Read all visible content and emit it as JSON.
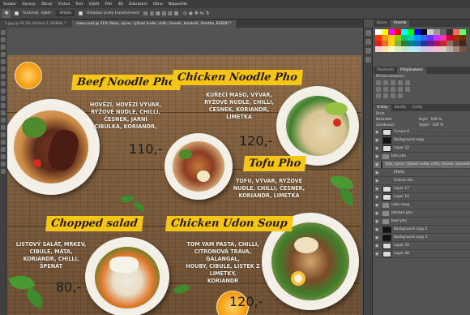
{
  "menubar": [
    "Soubor",
    "Úpravy",
    "Obraz",
    "Vrstva",
    "Text",
    "Výběr",
    "Filtr",
    "3D",
    "Zobrazení",
    "Okno",
    "Nápověda"
  ],
  "options": {
    "autoselect_label": "Automat. výběr:",
    "autoselect_value": "Vrstva",
    "transform_label": "Ovládací prvky transformace"
  },
  "tabs": [
    {
      "label": "1.jpg @ 33,3% (Vrstva 2, RGB/8) *"
    },
    {
      "label": "menu.psd @ 31% (Ikaly, vývar, rýžové nudle, chilli, česnek, koriandr, limetka, RGB/8) *"
    }
  ],
  "menu": {
    "items": [
      {
        "title": "Beef Noodle Pho",
        "desc": "HOVĚZÍ, HOVĚZÍ VÝVAR,\nRÝŽOVÉ NUDLE, CHILLI,\nČESNEK, JARNÍ\nCIBULKA, KORIANDR,",
        "price": "110,-"
      },
      {
        "title": "Chicken Noodle Pho",
        "desc": "KUŘECÍ MASO, VÝVAR,\nRÝŽOVÉ NUDLE, CHILLI,\nČESNEK, KORIANDR,\nLIMETKA",
        "price": "120,-"
      },
      {
        "title": "Tofu Pho",
        "desc": "TOFU, VÝVAR, RÝŽOVÉ\nNUDLE, CHILLI, ČESNEK,\nKORIANDR, LIMETKA",
        "price": ""
      },
      {
        "title": "Chopped salad",
        "desc": "LISTOVÝ SALÁT, MRKEV,\nCIBULE, MÁTA,\nKORIANDR, CHILLI,\nŠPENÁT",
        "price": "80,-"
      },
      {
        "title": "Chicken Udon Soup",
        "desc": "TOM YAM PASTA, CHILLI,\nCITRONOVÁ TRÁVA, GALANGAL,\nHOUBY, CIBULE, LÍSTEK Z LIMETKY,\nKORIANDR",
        "price": "120,-"
      }
    ]
  },
  "panels": {
    "color_tabs": [
      "Barva",
      "Vzorník"
    ],
    "props_tabs": [
      "Vlastnosti",
      "Přizpůsobení"
    ],
    "props_label": "Přidat nastavení",
    "layers_tabs": [
      "Vrstvy",
      "Kanály",
      "Cesty"
    ],
    "kind_label": "Druh",
    "blend_mode": "Normální",
    "opacity_label": "Krytí:",
    "opacity_value": "100 %",
    "lock_label": "Zamknout:",
    "fill_label": "Výplň:",
    "fill_value": "100 %",
    "layers": [
      {
        "name": "Curves 6",
        "thumb": "light",
        "sel": false
      },
      {
        "name": "Background copy",
        "thumb": "dark",
        "sel": false
      },
      {
        "name": "Layer 22",
        "thumb": "light",
        "sel": false
      },
      {
        "name": "tofu pho",
        "thumb": "folder",
        "sel": false
      },
      {
        "name": "tofu, vývar, rýžové nudle, chilli, česnek, koriandr, limetka",
        "thumb": "text",
        "sel": true
      },
      {
        "name": "Efekty",
        "thumb": "none",
        "sel": false
      },
      {
        "name": "Vržený stín",
        "thumb": "none",
        "sel": false
      },
      {
        "name": "Layer 17",
        "thumb": "light",
        "sel": false
      },
      {
        "name": "Layer 14",
        "thumb": "light",
        "sel": false
      },
      {
        "name": "udon soup",
        "thumb": "folder",
        "sel": false
      },
      {
        "name": "chicken pho",
        "thumb": "folder",
        "sel": false
      },
      {
        "name": "beef pho",
        "thumb": "folder",
        "sel": false
      },
      {
        "name": "Background copy 2",
        "thumb": "dark",
        "sel": false
      },
      {
        "name": "Background copy 3",
        "thumb": "dark",
        "sel": false
      },
      {
        "name": "Layer 29",
        "thumb": "light",
        "sel": false
      },
      {
        "name": "Layer 30",
        "thumb": "light",
        "sel": false
      }
    ],
    "swatch_colors": [
      "#ffffff",
      "#ffff00",
      "#ff00ff",
      "#ff0000",
      "#00ffff",
      "#00ff00",
      "#0000ff",
      "#000000",
      "#cccccc",
      "#999999",
      "#666666",
      "#333333",
      "#ff6666",
      "#66ff66",
      "#ff3300",
      "#ff9900",
      "#ffcc00",
      "#99cc00",
      "#00cc66",
      "#00cccc",
      "#0099ff",
      "#3366ff",
      "#6633ff",
      "#cc33ff",
      "#ff3399",
      "#cc0033",
      "#993300",
      "#663300",
      "#e41a1c",
      "#f06d26",
      "#ffd700",
      "#7cb342",
      "#2e7d32",
      "#00838f",
      "#1565c0",
      "#283593",
      "#6a1b9a",
      "#ad1457",
      "#c62828",
      "#8d6e63",
      "#5d4037",
      "#3e2723",
      "#ffcdd2",
      "#ffe0b2",
      "#fff9c4",
      "#dcedc8",
      "#c8e6c9",
      "#b2ebf2",
      "#bbdefb",
      "#c5cae9",
      "#e1bee7",
      "#f8bbd0",
      "#d7ccc8",
      "#bcaaa4",
      "#a1887f",
      "#795548"
    ]
  }
}
